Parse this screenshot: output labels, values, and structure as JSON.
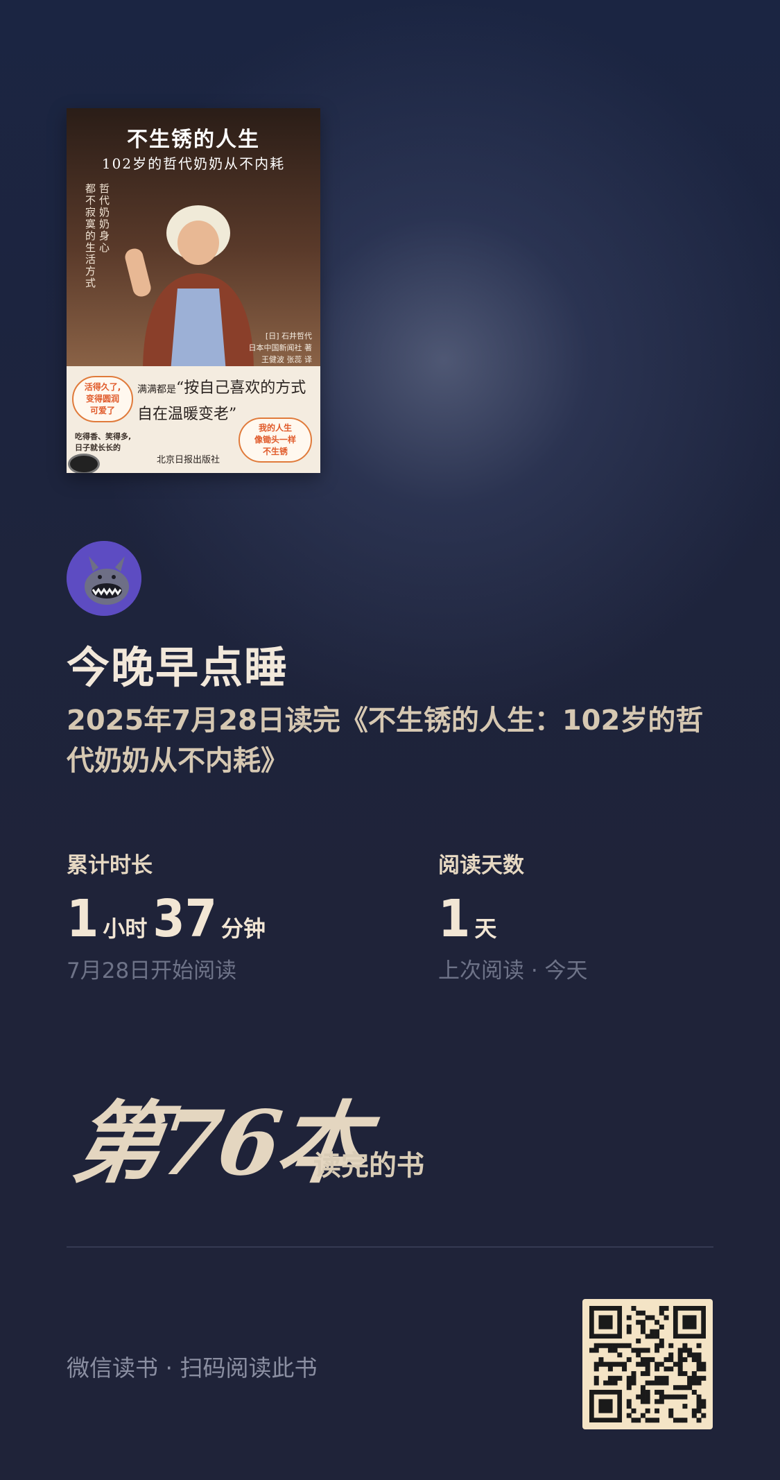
{
  "book": {
    "cover_title": "不生锈的人生",
    "cover_subtitle": "102岁的哲代奶奶从不内耗",
    "cover_vertical_1": "哲代奶奶身心",
    "cover_vertical_2": "都不寂寞的生活方式",
    "cover_credits": [
      "[日] 石井哲代",
      "日本中国新闻社 著",
      "王健波 张蕊 译"
    ],
    "cover_quote_prefix": "满满都是",
    "cover_quote_line1": "“按自己喜欢的方式",
    "cover_quote_line2": "自在温暖变老”",
    "bubble_left": [
      "活得久了,",
      "变得圆润",
      "可爱了"
    ],
    "bubble_right": [
      "我的人生",
      "像锄头一样",
      "不生锈"
    ],
    "cover_note": [
      "吃得香、笑得多,",
      "日子就长长的"
    ],
    "publisher": "北京日报出版社"
  },
  "user": {
    "name": "今晚早点睡"
  },
  "finish_text": "2025年7月28日读完《不生锈的人生：102岁的哲代奶奶从不内耗》",
  "stats": {
    "duration": {
      "label": "累计时长",
      "hours": "1",
      "hours_unit": "小时",
      "minutes": "37",
      "minutes_unit": "分钟",
      "sub": "7月28日开始阅读"
    },
    "days": {
      "label": "阅读天数",
      "value": "1",
      "unit": "天",
      "sub": "上次阅读 · 今天"
    }
  },
  "ordinal": {
    "text": "第76本",
    "suffix": "读完的书"
  },
  "footer": {
    "text": "微信读书 · 扫码阅读此书",
    "qr_icon": "qr-code-icon"
  },
  "colors": {
    "background": "#1f2339",
    "accent_text": "#f2e8da",
    "muted_text": "#6e7388"
  }
}
